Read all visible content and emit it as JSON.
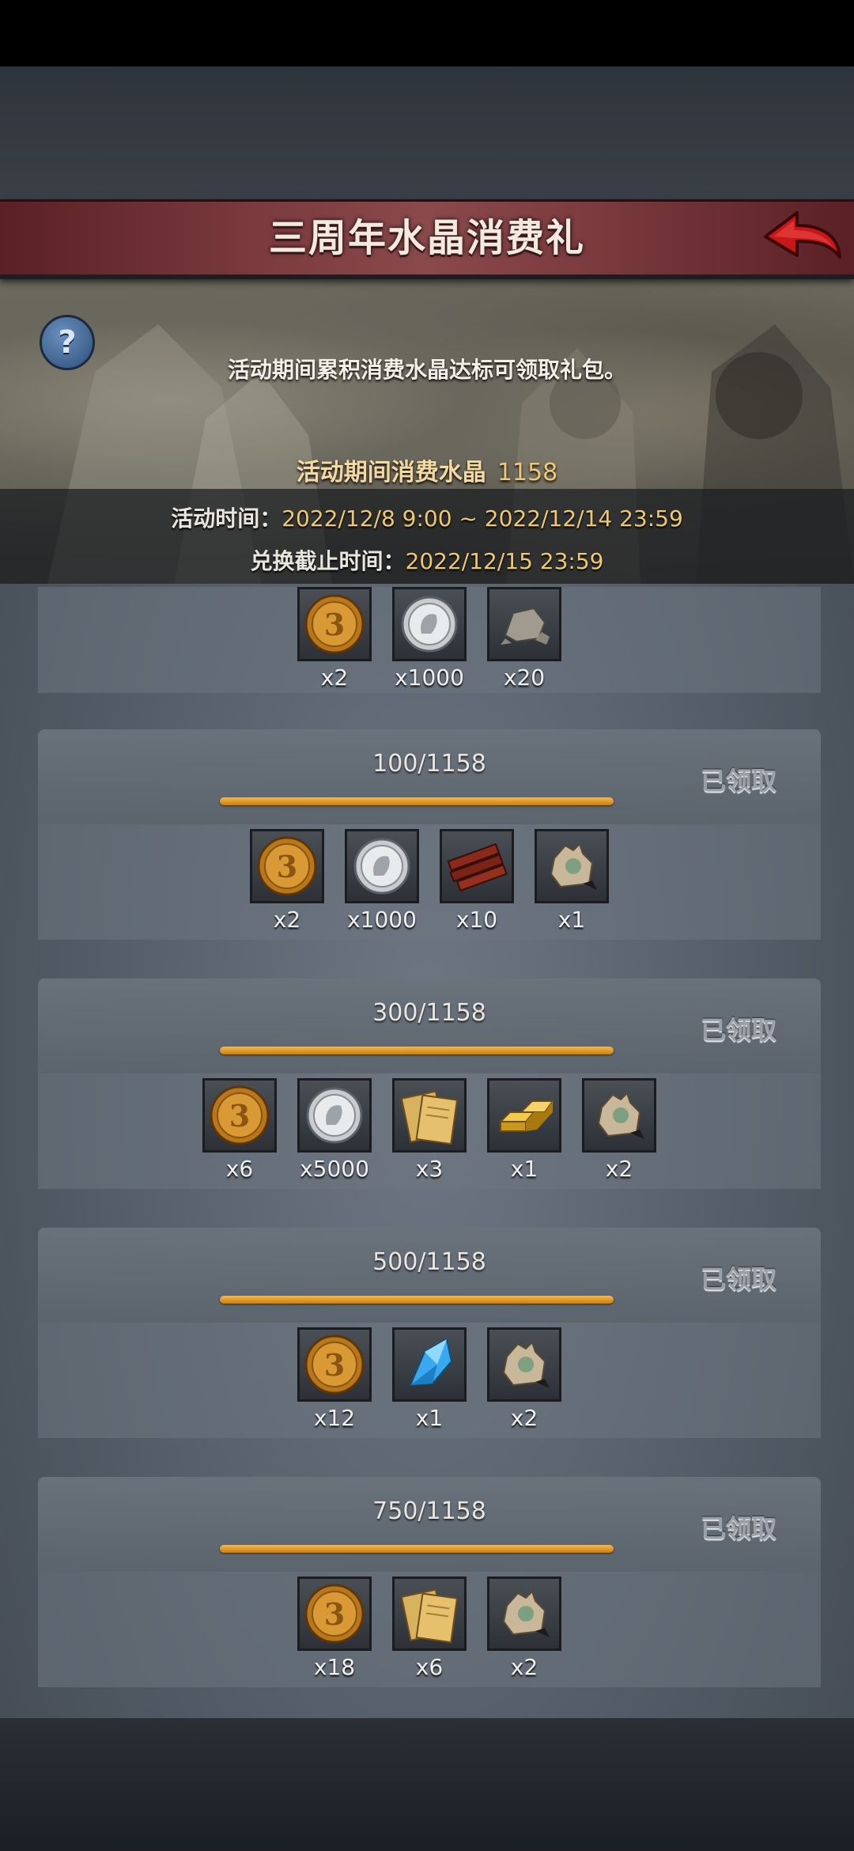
{
  "header": {
    "title": "三周年水晶消费礼"
  },
  "info": {
    "description": "活动期间累积消费水晶达标可领取礼包。",
    "spent_label": "活动期间消费水晶",
    "spent_value": "1158",
    "time_label": "活动时间：",
    "time_value": "2022/12/8 9:00 ~ 2022/12/14 23:59",
    "deadline_label": "兑换截止时间：",
    "deadline_value": "2022/12/15 23:59"
  },
  "tiers": [
    {
      "progress": "",
      "status": "",
      "items": [
        {
          "icon": "gold-coin-icon",
          "qty": "x2"
        },
        {
          "icon": "silver-coin-icon",
          "qty": "x1000"
        },
        {
          "icon": "stone-icon",
          "qty": "x20"
        }
      ]
    },
    {
      "progress": "100/1158",
      "progress_fraction": 1,
      "status": "已领取",
      "items": [
        {
          "icon": "gold-coin-icon",
          "qty": "x2"
        },
        {
          "icon": "silver-coin-icon",
          "qty": "x1000"
        },
        {
          "icon": "wood-icon",
          "qty": "x10"
        },
        {
          "icon": "bag-icon",
          "qty": "x1"
        }
      ]
    },
    {
      "progress": "300/1158",
      "progress_fraction": 1,
      "status": "已领取",
      "items": [
        {
          "icon": "gold-coin-icon",
          "qty": "x6"
        },
        {
          "icon": "silver-coin-icon",
          "qty": "x5000"
        },
        {
          "icon": "cards-icon",
          "qty": "x3"
        },
        {
          "icon": "gold-bars-icon",
          "qty": "x1"
        },
        {
          "icon": "bag-icon",
          "qty": "x2"
        }
      ]
    },
    {
      "progress": "500/1158",
      "progress_fraction": 1,
      "status": "已领取",
      "items": [
        {
          "icon": "gold-coin-icon",
          "qty": "x12"
        },
        {
          "icon": "crystal-icon",
          "qty": "x1"
        },
        {
          "icon": "bag-icon",
          "qty": "x2"
        }
      ]
    },
    {
      "progress": "750/1158",
      "progress_fraction": 1,
      "status": "已领取",
      "items": [
        {
          "icon": "gold-coin-icon",
          "qty": "x18"
        },
        {
          "icon": "cards-icon",
          "qty": "x6"
        },
        {
          "icon": "bag-icon",
          "qty": "x2"
        }
      ]
    }
  ]
}
